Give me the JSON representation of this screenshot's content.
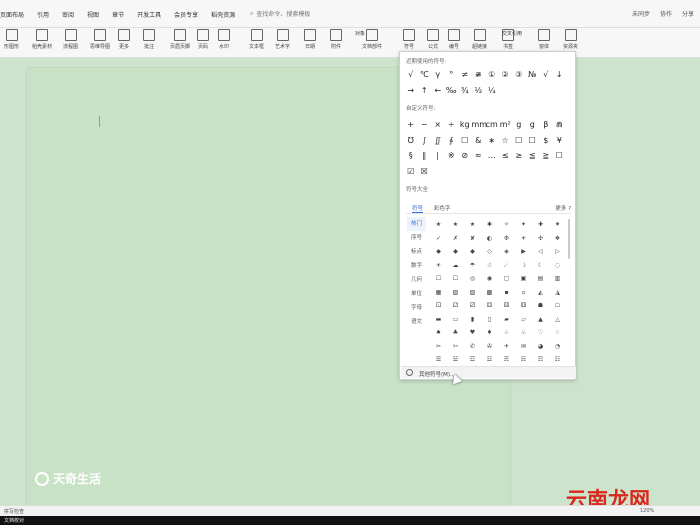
{
  "menubar": {
    "items": [
      "页面布局",
      "引用",
      "审阅",
      "视图",
      "章节",
      "开发工具",
      "会员专享",
      "稻壳资源"
    ],
    "search_placeholder": "查找命令、搜索模板",
    "right": [
      "未同步",
      "协作",
      "分享"
    ]
  },
  "ribbon": {
    "buttons": [
      {
        "label": "形图形"
      },
      {
        "label": "稻壳素材"
      },
      {
        "label": "流程图"
      },
      {
        "label": "思维导图"
      },
      {
        "label": "更多"
      },
      {
        "label": "批注"
      },
      {
        "label": "页眉页脚"
      },
      {
        "label": "页码"
      },
      {
        "label": "水印"
      },
      {
        "label": "文本框"
      },
      {
        "label": "艺术字"
      },
      {
        "label": "日期"
      },
      {
        "label": "附件"
      },
      {
        "label": "文档部件"
      },
      {
        "label": "符号"
      },
      {
        "label": "公式"
      },
      {
        "label": "编号"
      },
      {
        "label": "超链接"
      },
      {
        "label": "书签"
      },
      {
        "label": "窗体"
      },
      {
        "label": "资源夹"
      }
    ],
    "crossref_label": "交叉引用",
    "object_label": "对象"
  },
  "panel": {
    "recent_title": "近期使用的符号:",
    "recent_symbols": [
      "√",
      "℃",
      "γ",
      "°",
      "≠",
      "≇",
      "①",
      "②",
      "③",
      "№",
      "√",
      "↓",
      "→",
      "↑",
      "←",
      "‰",
      "¾",
      "½",
      "¼"
    ],
    "custom_title": "自定义符号:",
    "custom_symbols": [
      "+",
      "−",
      "×",
      "÷",
      "kg",
      "mm",
      "cm",
      "m²",
      "g",
      "g",
      "β",
      "⋒",
      "℧",
      "∫",
      "∬",
      "∮",
      "☐",
      "&",
      "∗",
      "☆",
      "☐",
      "☐",
      "$",
      "¥",
      "§",
      "∥",
      "∣",
      "※",
      "⊘",
      "≈",
      "…",
      "≤",
      "≥",
      "≦",
      "≧",
      "☐",
      "☑",
      "☒"
    ],
    "all_title": "符号大全",
    "tabs": [
      "符号",
      "彩色字"
    ],
    "tab_more": "更多 ?",
    "categories": [
      "热门",
      "序号",
      "标点",
      "数字",
      "几何",
      "单位",
      "字母",
      "语文"
    ],
    "grid_symbols": [
      [
        "★",
        "★",
        "★",
        "✱",
        "✧",
        "✦",
        "✚",
        "✷"
      ],
      [
        "✓",
        "✗",
        "✘",
        "◐",
        "Φ",
        "☀",
        "✣",
        "❖"
      ],
      [
        "◆",
        "◆",
        "◆",
        "◇",
        "◈",
        "▶",
        "◁",
        "▷"
      ],
      [
        "☀",
        "☁",
        "☂",
        "☃",
        "☄",
        "☽",
        "☾",
        "◌"
      ],
      [
        "☐",
        "☐",
        "◎",
        "◉",
        "▢",
        "▣",
        "▤",
        "▥"
      ],
      [
        "▦",
        "▧",
        "▨",
        "▩",
        "▪",
        "▫",
        "◭",
        "◮"
      ],
      [
        "⚀",
        "⚁",
        "⚂",
        "⚃",
        "⚄",
        "⚅",
        "☗",
        "☖"
      ],
      [
        "▬",
        "▭",
        "▮",
        "▯",
        "▰",
        "▱",
        "▲",
        "△"
      ],
      [
        "♠",
        "♣",
        "♥",
        "♦",
        "♤",
        "♧",
        "♡",
        "♢"
      ],
      [
        "✂",
        "✄",
        "✆",
        "✇",
        "✈",
        "✉",
        "◕",
        "◔"
      ],
      [
        "☰",
        "☱",
        "☲",
        "☳",
        "☴",
        "☵",
        "☶",
        "☷"
      ]
    ],
    "footer": "其他符号(M)..."
  },
  "statusbar": {
    "left": "拼写检查",
    "left2": "文档校对",
    "zoom": "120%"
  },
  "watermark": "天奇生活",
  "logo": "云南龙网"
}
